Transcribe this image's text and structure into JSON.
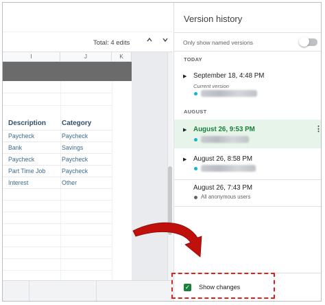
{
  "toolbar": {
    "edits_label": "Total: 4 edits",
    "nav_up": "^",
    "nav_down": "v"
  },
  "sheet": {
    "columns": [
      "I",
      "J",
      "K"
    ],
    "header": {
      "description": "Description",
      "category": "Category"
    },
    "rows": [
      {
        "description": "Paycheck",
        "category": "Paycheck"
      },
      {
        "description": "Bank",
        "category": "Savings"
      },
      {
        "description": "Paycheck",
        "category": "Paycheck"
      },
      {
        "description": "Part Time Job",
        "category": "Paycheck"
      },
      {
        "description": "Interest",
        "category": "Other"
      }
    ]
  },
  "panel": {
    "title": "Version history",
    "named_only_label": "Only show named versions",
    "named_only_enabled": false,
    "sections": {
      "today": "TODAY",
      "august": "AUGUST"
    },
    "versions": [
      {
        "date": "September 18, 4:48 PM",
        "sub": "Current version",
        "selected": false,
        "expand": "▶"
      },
      {
        "date": "August 26, 9:53 PM",
        "selected": true,
        "expand": "▶",
        "more": "⋮"
      },
      {
        "date": "August 26, 8:58 PM",
        "selected": false,
        "expand": "▶"
      },
      {
        "date": "August 26, 7:43 PM",
        "author": "All anonymous users",
        "selected": false
      }
    ],
    "show_changes_label": "Show changes",
    "show_changes_checked": true,
    "check_glyph": "✓"
  },
  "colors": {
    "selected_green": "#188038",
    "selected_bg": "#e6f4ea",
    "author_dot": "#12b5cb",
    "highlight_red": "#e0201b",
    "arrow_red": "#c0100c"
  }
}
